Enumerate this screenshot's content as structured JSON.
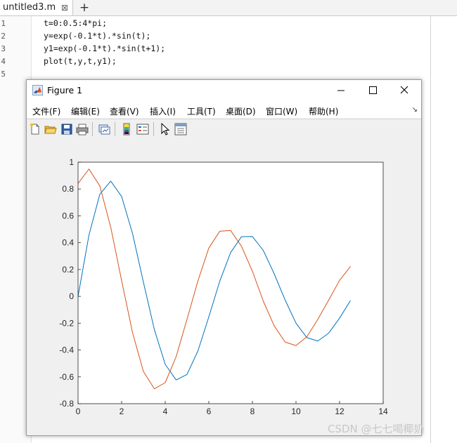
{
  "editor": {
    "tab_title": "untitled3.m",
    "tab_close": "⊠",
    "tab_add": "+",
    "line_numbers": [
      "1",
      "2",
      "3",
      "4",
      "5"
    ],
    "lines": [
      "t=0:0.5:4*pi;",
      "y=exp(-0.1*t).*sin(t);",
      "y1=exp(-0.1*t).*sin(t+1);",
      "plot(t,y,t,y1);",
      ""
    ]
  },
  "figure": {
    "title": "Figure 1",
    "menu": [
      "文件(F)",
      "编辑(E)",
      "查看(V)",
      "插入(I)",
      "工具(T)",
      "桌面(D)",
      "窗口(W)",
      "帮助(H)"
    ],
    "menu_more": "↘"
  },
  "toolbar_icons": [
    "new-figure-icon",
    "open-file-icon",
    "save-icon",
    "print-icon",
    "link-plot-icon",
    "insert-colorbar-icon",
    "insert-legend-icon",
    "edit-plot-icon",
    "property-inspector-icon"
  ],
  "watermark": "CSDN @七七喝椰奶",
  "chart_data": {
    "type": "line",
    "title": "",
    "xlabel": "",
    "ylabel": "",
    "xlim": [
      0,
      14
    ],
    "ylim": [
      -0.8,
      1
    ],
    "xticks": [
      0,
      2,
      4,
      6,
      8,
      10,
      12,
      14
    ],
    "yticks": [
      -0.8,
      -0.6,
      -0.4,
      -0.2,
      0,
      0.2,
      0.4,
      0.6,
      0.8,
      1
    ],
    "ytick_labels": [
      "-0.8",
      "-0.6",
      "-0.4",
      "-0.2",
      "0",
      "0.2",
      "0.4",
      "0.6",
      "0.8",
      "1"
    ],
    "grid": false,
    "x": [
      0,
      0.5,
      1,
      1.5,
      2,
      2.5,
      3,
      3.5,
      4,
      4.5,
      5,
      5.5,
      6,
      6.5,
      7,
      7.5,
      8,
      8.5,
      9,
      9.5,
      10,
      10.5,
      11,
      11.5,
      12,
      12.5
    ],
    "series": [
      {
        "color": "#0072bd",
        "values": [
          0,
          0.456,
          0.761,
          0.859,
          0.744,
          0.468,
          0.105,
          -0.247,
          -0.507,
          -0.623,
          -0.582,
          -0.407,
          -0.153,
          0.112,
          0.326,
          0.445,
          0.446,
          0.342,
          0.168,
          -0.027,
          -0.2,
          -0.308,
          -0.333,
          -0.274,
          -0.162,
          -0.031
        ]
      },
      {
        "color": "#d95319",
        "values": [
          0.841,
          0.949,
          0.823,
          0.515,
          0.117,
          -0.27,
          -0.56,
          -0.689,
          -0.643,
          -0.45,
          -0.17,
          0.115,
          0.36,
          0.485,
          0.491,
          0.373,
          0.187,
          -0.036,
          -0.22,
          -0.341,
          -0.367,
          -0.301,
          -0.172,
          -0.028,
          0.12,
          0.223
        ]
      }
    ]
  }
}
